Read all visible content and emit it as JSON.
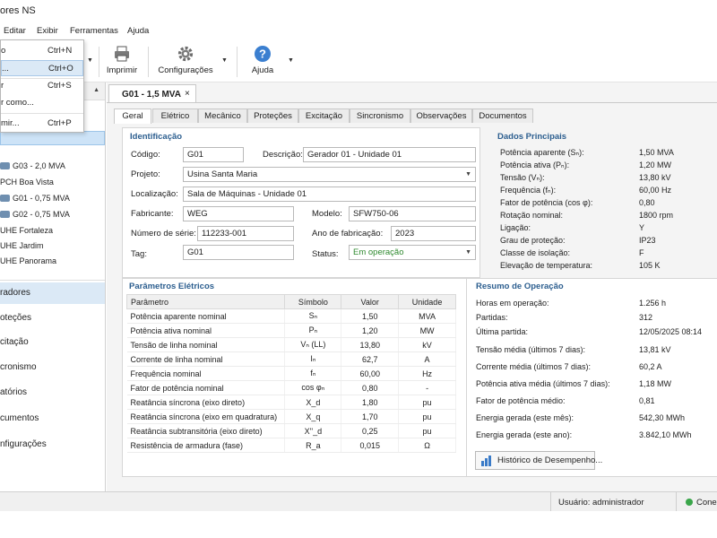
{
  "window": {
    "title": "ores NS"
  },
  "menu": {
    "items": [
      "Editar",
      "Exibir",
      "Ferramentas",
      "Ajuda"
    ]
  },
  "file_menu": {
    "items": [
      {
        "label": "o",
        "shortcut": "Ctrl+N"
      },
      {
        "label": "...",
        "shortcut": "Ctrl+O"
      },
      {
        "label": "r",
        "shortcut": "Ctrl+S"
      },
      {
        "label": "r como...",
        "shortcut": ""
      },
      {
        "label": "mir...",
        "shortcut": "Ctrl+P"
      }
    ]
  },
  "toolbar": {
    "print_label": "Imprimir",
    "settings_label": "Configurações",
    "help_label": "Ajuda"
  },
  "tree": {
    "items": [
      {
        "label": "G03 - 2,0 MVA",
        "type": "generator"
      },
      {
        "label": "PCH Boa Vista",
        "type": "plant"
      },
      {
        "label": "G01 - 0,75 MVA",
        "type": "generator"
      },
      {
        "label": "G02 - 0,75 MVA",
        "type": "generator"
      },
      {
        "label": "UHE Fortaleza",
        "type": "plant"
      },
      {
        "label": "UHE Jardim",
        "type": "plant"
      },
      {
        "label": "UHE Panorama",
        "type": "plant"
      }
    ]
  },
  "nav": {
    "items": [
      "radores",
      "oteções",
      "citação",
      "cronismo",
      "atórios",
      "cumentos",
      "nfigurações"
    ],
    "active_index": 0
  },
  "doc_tab": {
    "title": "G01 - 1,5 MVA",
    "close": "×"
  },
  "tabs": [
    "Geral",
    "Elétrico",
    "Mecânico",
    "Proteções",
    "Excitação",
    "Sincronismo",
    "Observações",
    "Documentos"
  ],
  "identification": {
    "title": "Identificação",
    "codigo_label": "Código:",
    "codigo": "G01",
    "descricao_label": "Descrição:",
    "descricao": "Gerador 01 - Unidade 01",
    "projeto_label": "Projeto:",
    "projeto": "Usina Santa Maria",
    "localizacao_label": "Localização:",
    "localizacao": "Sala de Máquinas - Unidade 01",
    "fabricante_label": "Fabricante:",
    "fabricante": "WEG",
    "modelo_label": "Modelo:",
    "modelo": "SFW750-06",
    "numero_serie_label": "Número de série:",
    "numero_serie": "112233-001",
    "ano_label": "Ano de fabricação:",
    "ano": "2023",
    "tag_label": "Tag:",
    "tag": "G01",
    "status_label": "Status:",
    "status": "Em operação",
    "status_color": "#2f8a2f"
  },
  "main_data": {
    "title": "Dados Principais",
    "rows": [
      {
        "label": "Potência aparente (Sₙ):",
        "value": "1,50 MVA"
      },
      {
        "label": "Potência ativa (Pₙ):",
        "value": "1,20 MW"
      },
      {
        "label": "Tensão (Vₙ):",
        "value": "13,80 kV"
      },
      {
        "label": "Frequência (fₙ):",
        "value": "60,00 Hz"
      },
      {
        "label": "Fator de potência (cos φ):",
        "value": "0,80"
      },
      {
        "label": "Rotação nominal:",
        "value": "1800 rpm"
      },
      {
        "label": "Ligação:",
        "value": "Y"
      },
      {
        "label": "Grau de proteção:",
        "value": "IP23"
      },
      {
        "label": "Classe de isolação:",
        "value": "F"
      },
      {
        "label": "Elevação de temperatura:",
        "value": "105 K"
      }
    ]
  },
  "electrical": {
    "title": "Parâmetros Elétricos",
    "headers": [
      "Parâmetro",
      "Símbolo",
      "Valor",
      "Unidade"
    ],
    "rows": [
      {
        "param": "Potência aparente nominal",
        "symbol": "Sₙ",
        "value": "1,50",
        "unit": "MVA"
      },
      {
        "param": "Potência ativa nominal",
        "symbol": "Pₙ",
        "value": "1,20",
        "unit": "MW"
      },
      {
        "param": "Tensão de linha nominal",
        "symbol": "Vₙ (LL)",
        "value": "13,80",
        "unit": "kV"
      },
      {
        "param": "Corrente de linha nominal",
        "symbol": "Iₙ",
        "value": "62,7",
        "unit": "A"
      },
      {
        "param": "Frequência nominal",
        "symbol": "fₙ",
        "value": "60,00",
        "unit": "Hz"
      },
      {
        "param": "Fator de potência nominal",
        "symbol": "cos φₙ",
        "value": "0,80",
        "unit": "-"
      },
      {
        "param": "Reatância síncrona (eixo direto)",
        "symbol": "X_d",
        "value": "1,80",
        "unit": "pu"
      },
      {
        "param": "Reatância síncrona (eixo em quadratura)",
        "symbol": "X_q",
        "value": "1,70",
        "unit": "pu"
      },
      {
        "param": "Reatância subtransitória (eixo direto)",
        "symbol": "X''_d",
        "value": "0,25",
        "unit": "pu"
      },
      {
        "param": "Resistência de armadura (fase)",
        "symbol": "R_a",
        "value": "0,015",
        "unit": "Ω"
      }
    ]
  },
  "operation": {
    "title": "Resumo de Operação",
    "rows": [
      {
        "label": "Horas em operação:",
        "value": "1.256 h"
      },
      {
        "label": "Partidas:",
        "value": "312"
      },
      {
        "label": "Última partida:",
        "value": "12/05/2025 08:14"
      },
      {
        "label": "Tensão média (últimos 7 dias):",
        "value": "13,81 kV"
      },
      {
        "label": "Corrente média (últimos 7 dias):",
        "value": "60,2 A"
      },
      {
        "label": "Potência ativa média (últimos 7 dias):",
        "value": "1,18 MW"
      },
      {
        "label": "Fator de potência médio:",
        "value": "0,81"
      },
      {
        "label": "Energia gerada (este mês):",
        "value": "542,30 MWh"
      },
      {
        "label": "Energia gerada (este ano):",
        "value": "3.842,10 MWh"
      }
    ],
    "history_button": "Histórico de Desempenho..."
  },
  "status": {
    "user": "Usuário: administrador",
    "connection": "Conec"
  }
}
